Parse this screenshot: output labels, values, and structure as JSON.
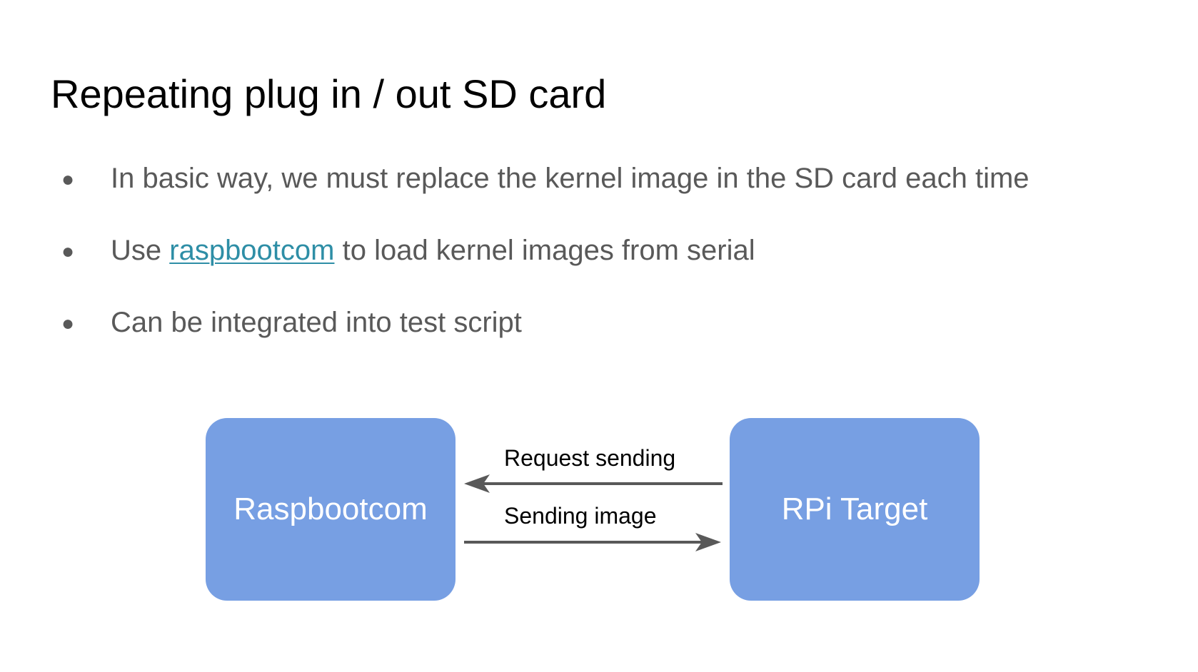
{
  "slide": {
    "title": "Repeating plug in / out SD card",
    "bullets": [
      {
        "dot": "●",
        "before": "In basic way, we must replace the kernel image in the SD card each time",
        "link": "",
        "after": ""
      },
      {
        "dot": "●",
        "before": "Use ",
        "link": "raspbootcom",
        "after": " to load kernel images from serial"
      },
      {
        "dot": "●",
        "before": "Can be integrated into test script",
        "link": "",
        "after": ""
      }
    ]
  },
  "diagram": {
    "nodes": {
      "left": "Raspbootcom",
      "right": "RPi Target"
    },
    "edges": {
      "top": {
        "label": "Request sending",
        "direction": "right-to-left"
      },
      "bottom": {
        "label": "Sending image",
        "direction": "left-to-right"
      }
    },
    "colors": {
      "node_fill": "#779fe3",
      "node_text": "#ffffff",
      "arrow": "#595959",
      "link": "#2e8ea6",
      "bullet_text": "#595959"
    }
  }
}
